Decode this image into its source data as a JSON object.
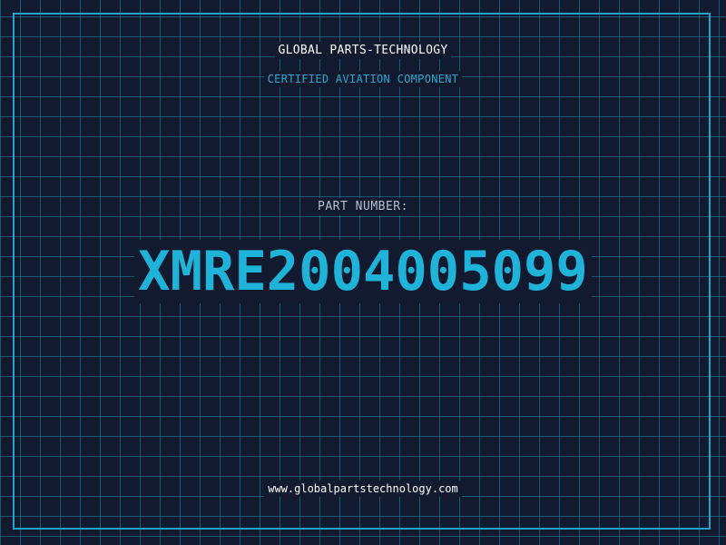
{
  "header": {
    "company": "GLOBAL PARTS-TECHNOLOGY",
    "subtitle": "CERTIFIED AVIATION COMPONENT"
  },
  "part": {
    "label": "PART NUMBER:",
    "number": "XMRE2004005099"
  },
  "footer": {
    "website": "www.globalpartstechnology.com"
  },
  "colors": {
    "background": "#121a2f",
    "grid": "#1e8ca5",
    "accent": "#1fb3d9",
    "text_primary": "#ffffff",
    "text_muted": "#b8c0cc"
  }
}
